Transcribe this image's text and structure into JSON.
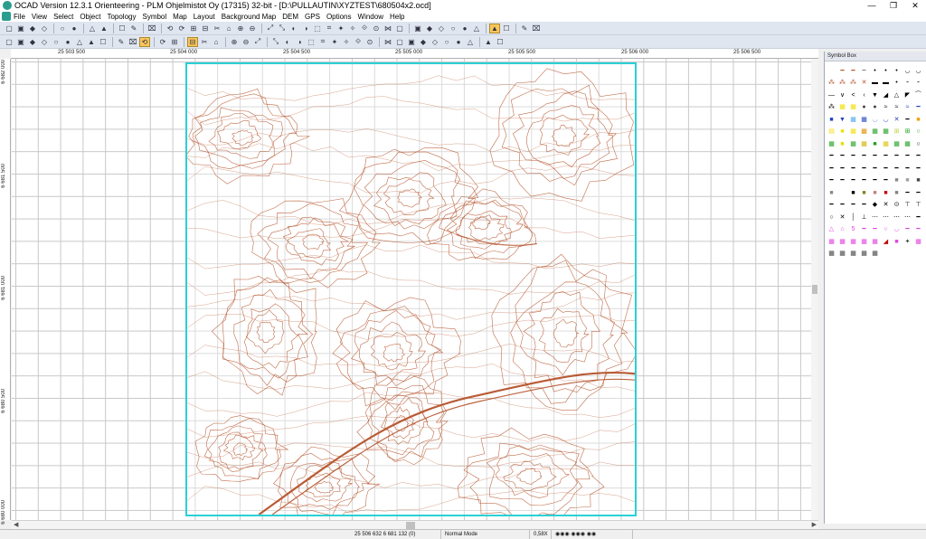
{
  "window": {
    "title": "OCAD Version 12.3.1  Orienteering - PLM Ohjelmistot Oy (17315) 32-bit - [D:\\PULLAUTIN\\XYZTEST\\680504x2.ocd]",
    "minimize": "—",
    "restore": "❐",
    "close": "✕"
  },
  "menu": [
    "File",
    "View",
    "Select",
    "Object",
    "Topology",
    "Symbol",
    "Map",
    "Layout",
    "Background Map",
    "DEM",
    "GPS",
    "Options",
    "Window",
    "Help"
  ],
  "toolbar1": [
    "new-file-icon",
    "open-file-icon",
    "save-icon",
    "print-icon",
    "sep",
    "undo-icon",
    "redo-icon",
    "sep",
    "fit-view-icon",
    "cut-icon",
    "sep",
    "paint-icon",
    "color-icon",
    "sep",
    "close-icon",
    "sep",
    "tool-a-icon",
    "tool-b-icon",
    "tool-c-icon",
    "tool-d-icon",
    "tool-e-icon",
    "tool-f-icon",
    "tool-g-icon",
    "tool-h-icon",
    "sep",
    "tool-i-icon",
    "tool-j-icon",
    "tool-k-icon",
    "tool-l-icon",
    "tool-m-icon",
    "tool-n-icon",
    "tool-o-icon",
    "tool-p-icon",
    "tool-q-icon",
    "tool-r-icon",
    "tool-s-icon",
    "tool-t-icon",
    "sep",
    "tool-u-icon",
    "tool-v-icon",
    "tool-w-icon",
    "tool-x-icon",
    "tool-y-icon",
    "tool-z-icon",
    "sep",
    "gps-person-icon",
    "bitmap-icon",
    "sep",
    "window-icon",
    "link-icon"
  ],
  "toolbar2": [
    "zoom-in-icon",
    "hand-icon",
    "zoom-window-icon",
    "zoom-out-icon",
    "magnify-icon",
    "find-icon",
    "fit-icon",
    "zoom-rect-icon",
    "zoom-area-icon",
    "sep",
    "back-icon",
    "forward-icon",
    "grid-icon",
    "sep",
    "layout-icon",
    "layout2-icon",
    "sep",
    "select-pointer-icon",
    "edit-point-icon",
    "lasso-icon",
    "sep",
    "rect-select-icon",
    "move-icon",
    "rotate-icon",
    "sep",
    "tool-2a-icon",
    "tool-2b-icon",
    "tool-2c-icon",
    "tool-2d-icon",
    "tool-2e-icon",
    "tool-2f-icon",
    "tool-2g-icon",
    "tool-2h-icon",
    "tool-2i-icon",
    "sep",
    "draw-line-icon",
    "draw-circle-icon",
    "draw-ellipse-icon",
    "draw-curve-icon",
    "draw-rect-icon",
    "draw-straight-icon",
    "draw-free-icon",
    "draw-number-icon",
    "sep",
    "tool-2j-icon",
    "tool-2k-icon"
  ],
  "ruler_top": [
    "25 503 500",
    "25 504 000",
    "25 504 500",
    "25 505 000",
    "25 505 500",
    "25 506 000",
    "25 506 500"
  ],
  "ruler_left": [
    "6 682 000",
    "6 681 500",
    "6 681 000",
    "6 680 500",
    "6 680 000"
  ],
  "symbol_box": {
    "title": "Symbol Box"
  },
  "statusbar": {
    "coordinates": "25 506 632   6 681 132   (0)",
    "mode": "Normal Mode",
    "zoom": "0,58X"
  },
  "colors": {
    "contour": "#b5532a",
    "map_border": "#2ad0d6",
    "active_tool": "#f7c55a"
  }
}
